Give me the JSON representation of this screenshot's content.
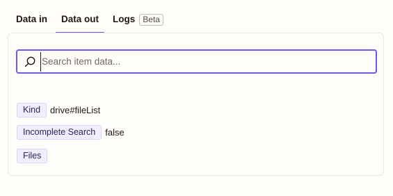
{
  "tabs": [
    {
      "label": "Data in",
      "active": false
    },
    {
      "label": "Data out",
      "active": true
    },
    {
      "label": "Logs",
      "badge": "Beta",
      "active": false
    }
  ],
  "search": {
    "placeholder": "Search item data...",
    "value": ""
  },
  "items": [
    {
      "key": "Kind",
      "value": "drive#fileList"
    },
    {
      "key": "Incomplete Search",
      "value": "false"
    },
    {
      "key": "Files",
      "value": ""
    }
  ],
  "colors": {
    "accent": "#695be8",
    "key_bg": "#f1efff",
    "background": "#fffdf9"
  },
  "icons": {
    "search": "search-icon"
  }
}
